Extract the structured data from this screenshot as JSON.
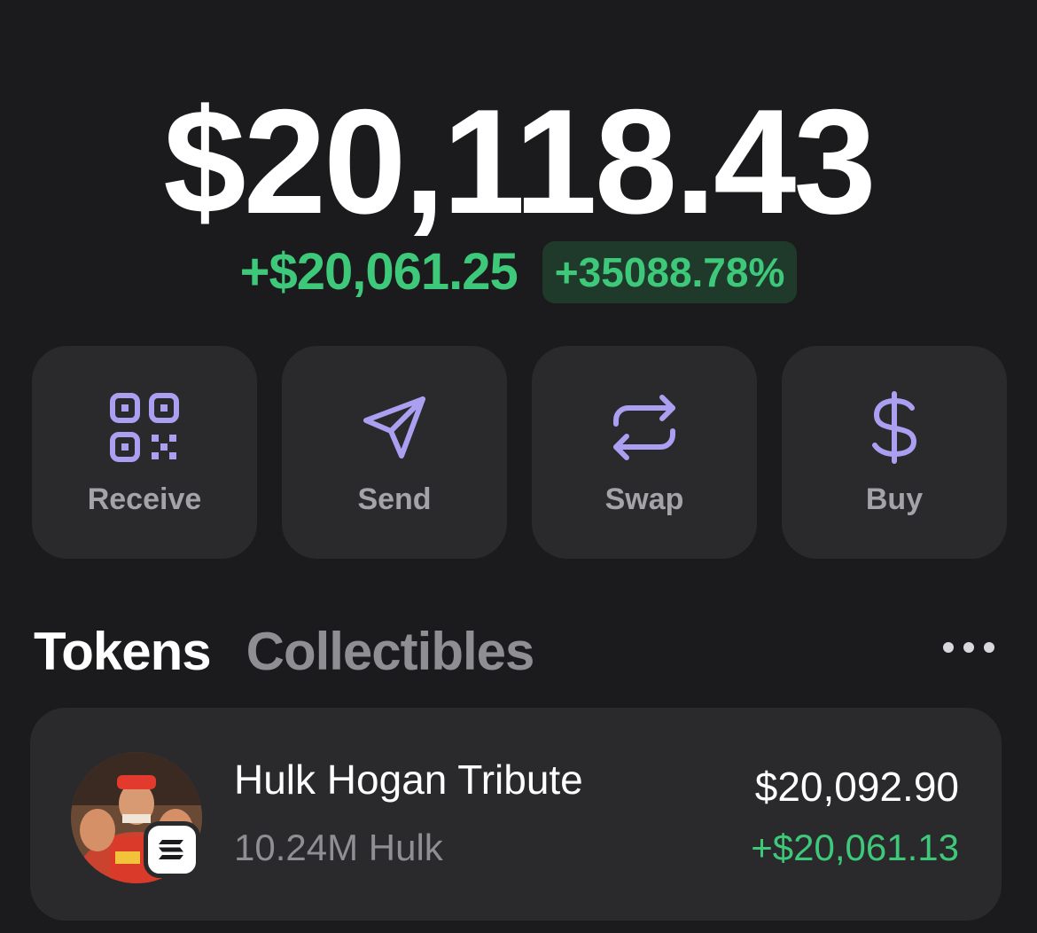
{
  "wallet": {
    "balance": "$20,118.43",
    "change_abs": "+$20,061.25",
    "change_pct": "+35088.78%"
  },
  "actions": [
    {
      "label": "Receive",
      "icon": "qr-code-icon"
    },
    {
      "label": "Send",
      "icon": "send-icon"
    },
    {
      "label": "Swap",
      "icon": "swap-icon"
    },
    {
      "label": "Buy",
      "icon": "dollar-icon"
    }
  ],
  "tabs": [
    {
      "label": "Tokens",
      "active": true
    },
    {
      "label": "Collectibles",
      "active": false
    }
  ],
  "tokens": [
    {
      "name": "Hulk Hogan Tribute",
      "amount": "10.24M Hulk",
      "value": "$20,092.90",
      "change": "+$20,061.13",
      "chain_icon": "solana-icon"
    }
  ],
  "colors": {
    "background": "#1b1b1d",
    "card": "#2a2a2c",
    "accent": "#ab9ff2",
    "positive": "#3ec97a"
  }
}
